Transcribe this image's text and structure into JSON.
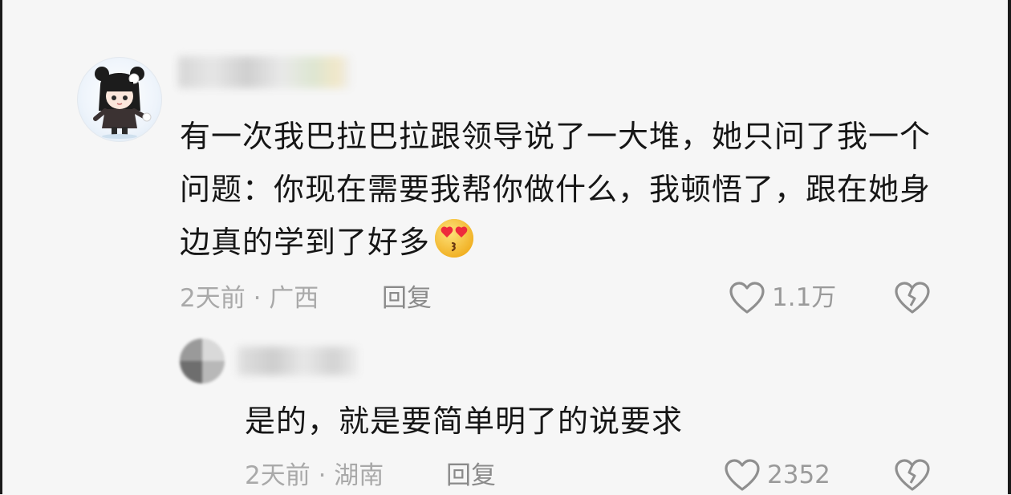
{
  "comment": {
    "text": "有一次我巴拉巴拉跟领导说了一大堆，她只问了我一个问题：你现在需要我帮你做什么，我顿悟了，跟在她身边真的学到了好多",
    "emoji": "heart-eyes-kiss-emoji",
    "time_location": "2天前 · 广西",
    "reply_label": "回复",
    "like_count": "1.1万"
  },
  "reply": {
    "text": "是的，就是要简单明了的说要求",
    "time_location": "2天前 · 湖南",
    "reply_label": "回复",
    "like_count": "2352"
  },
  "colors": {
    "background": "#f6f6f6",
    "text": "#161616",
    "meta": "#a9a9a9",
    "icon": "#8f8f8f"
  }
}
